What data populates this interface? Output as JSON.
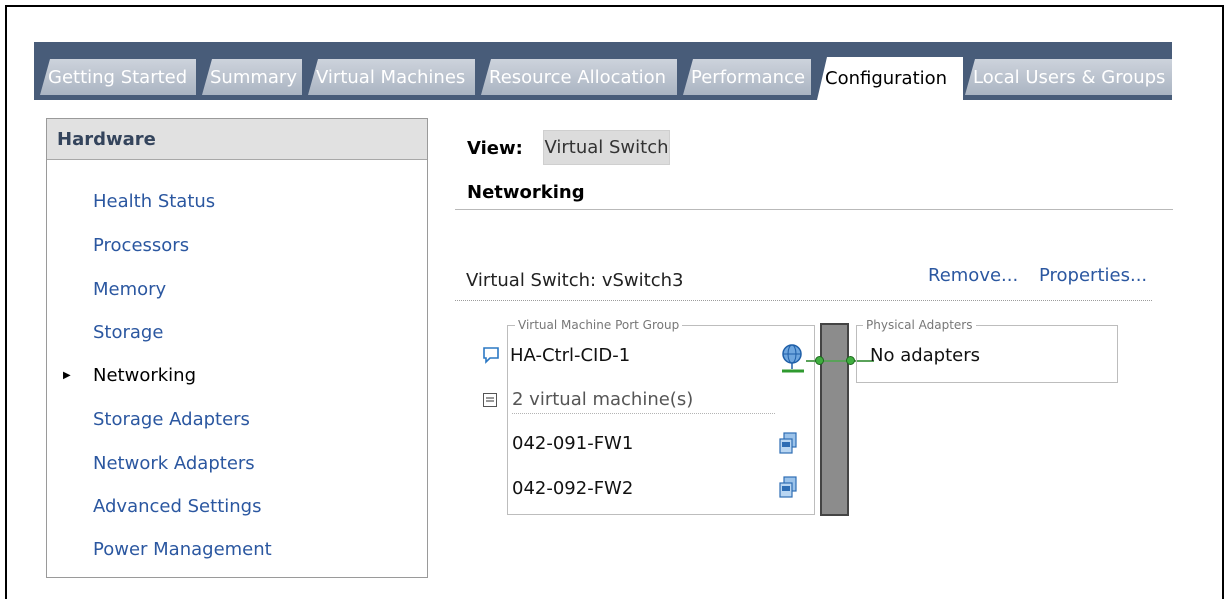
{
  "tabs": [
    {
      "label": "Getting Started",
      "active": false
    },
    {
      "label": "Summary",
      "active": false
    },
    {
      "label": "Virtual Machines",
      "active": false
    },
    {
      "label": "Resource Allocation",
      "active": false
    },
    {
      "label": "Performance",
      "active": false
    },
    {
      "label": "Configuration",
      "active": true
    },
    {
      "label": "Local Users & Groups",
      "active": false
    }
  ],
  "hardware": {
    "title": "Hardware",
    "items": [
      {
        "label": "Health Status"
      },
      {
        "label": "Processors"
      },
      {
        "label": "Memory"
      },
      {
        "label": "Storage"
      },
      {
        "label": "Networking",
        "selected": true
      },
      {
        "label": "Storage Adapters"
      },
      {
        "label": "Network Adapters"
      },
      {
        "label": "Advanced Settings"
      },
      {
        "label": "Power Management"
      }
    ]
  },
  "view": {
    "label": "View:",
    "value": "Virtual Switch"
  },
  "section_title": "Networking",
  "vswitch": {
    "label": "Virtual Switch: vSwitch3",
    "remove_link": "Remove...",
    "properties_link": "Properties...",
    "port_group": {
      "legend": "Virtual Machine Port Group",
      "name": "HA-Ctrl-CID-1",
      "vm_count": "2 virtual machine(s)",
      "vms": [
        {
          "name": "042-091-FW1"
        },
        {
          "name": "042-092-FW2"
        }
      ]
    },
    "physical_adapters": {
      "legend": "Physical Adapters",
      "value": "No adapters"
    }
  },
  "colors": {
    "tab_bar": "#485c79",
    "link": "#2b57a0",
    "connector": "#3fae3f"
  }
}
